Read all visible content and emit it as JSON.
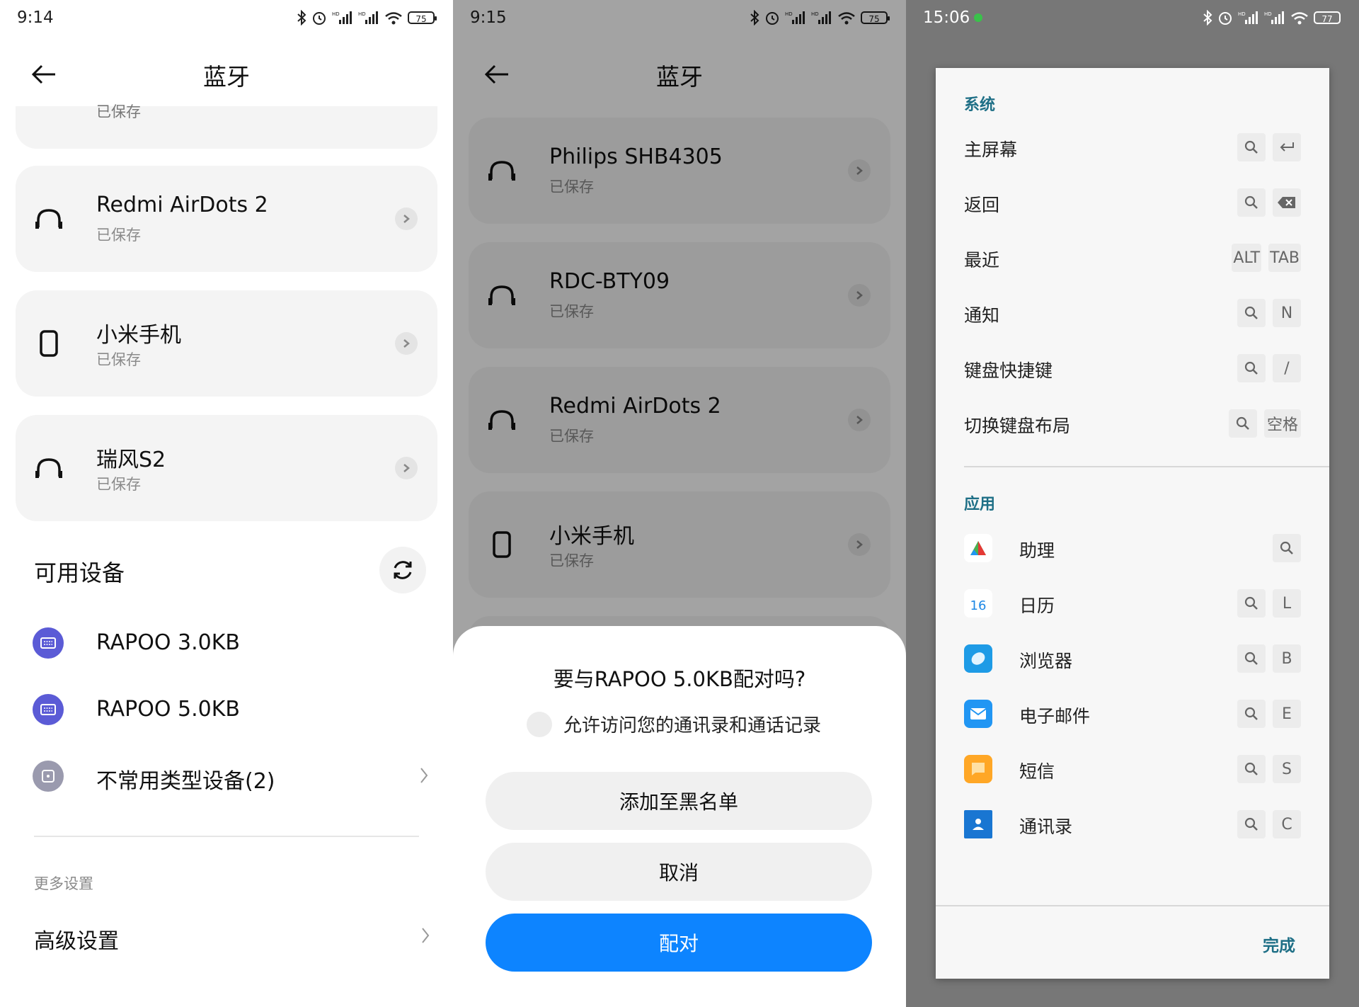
{
  "panel1": {
    "status": {
      "time": "9:14",
      "battery": "75"
    },
    "title": "蓝牙",
    "partial_card_sub": "已保存",
    "saved_devices": [
      {
        "name": "Redmi AirDots 2",
        "sub": "已保存",
        "icon": "headphones-icon"
      },
      {
        "name": "小米手机",
        "sub": "已保存",
        "icon": "phone-icon"
      },
      {
        "name": "瑞风S2",
        "sub": "已保存",
        "icon": "headphones-icon"
      }
    ],
    "available_title": "可用设备",
    "available_devices": [
      {
        "name": "RAPOO 3.0KB",
        "icon": "keyboard-icon",
        "color": "#5b5bd6"
      },
      {
        "name": "RAPOO 5.0KB",
        "icon": "keyboard-icon",
        "color": "#5b5bd6"
      },
      {
        "name": "不常用类型设备(2)",
        "icon": "device-icon",
        "color": "#9a9aae"
      }
    ],
    "more_settings_label": "更多设置",
    "advanced_settings": "高级设置"
  },
  "panel2": {
    "status": {
      "time": "9:15",
      "battery": "75"
    },
    "title": "蓝牙",
    "saved_devices": [
      {
        "name": "Philips SHB4305",
        "sub": "已保存",
        "icon": "headphones-icon"
      },
      {
        "name": "RDC-BTY09",
        "sub": "已保存",
        "icon": "headphones-icon"
      },
      {
        "name": "Redmi AirDots 2",
        "sub": "已保存",
        "icon": "headphones-icon"
      },
      {
        "name": "小米手机",
        "sub": "已保存",
        "icon": "phone-icon"
      }
    ],
    "sheet": {
      "question": "要与RAPOO 5.0KB配对吗?",
      "checkbox_label": "允许访问您的通讯录和通话记录",
      "blacklist_button": "添加至黑名单",
      "cancel_button": "取消",
      "pair_button": "配对",
      "primary_color": "#0d84ff"
    }
  },
  "panel3": {
    "status": {
      "time": "15:06",
      "battery": "77"
    },
    "system_group": "系统",
    "system_rows": [
      {
        "label": "主屏幕",
        "keys": [
          "search",
          "↩"
        ]
      },
      {
        "label": "返回",
        "keys": [
          "search",
          "backspace"
        ]
      },
      {
        "label": "最近",
        "keys": [
          "ALT",
          "TAB"
        ]
      },
      {
        "label": "通知",
        "keys": [
          "search",
          "N"
        ]
      },
      {
        "label": "键盘快捷键",
        "keys": [
          "search",
          "/"
        ]
      },
      {
        "label": "切换键盘布局",
        "keys": [
          "search",
          "空格"
        ]
      }
    ],
    "apps_group": "应用",
    "app_rows": [
      {
        "label": "助理",
        "icon": "assistant-icon",
        "keys": [
          "search"
        ]
      },
      {
        "label": "日历",
        "icon": "calendar-icon",
        "calendar_day": "16",
        "keys": [
          "search",
          "L"
        ]
      },
      {
        "label": "浏览器",
        "icon": "browser-icon",
        "keys": [
          "search",
          "B"
        ]
      },
      {
        "label": "电子邮件",
        "icon": "email-icon",
        "keys": [
          "search",
          "E"
        ]
      },
      {
        "label": "短信",
        "icon": "sms-icon",
        "keys": [
          "search",
          "S"
        ]
      },
      {
        "label": "通讯录",
        "icon": "contacts-icon",
        "keys": [
          "search",
          "C"
        ]
      }
    ],
    "done_button": "完成",
    "accent": "#1e6f86"
  }
}
